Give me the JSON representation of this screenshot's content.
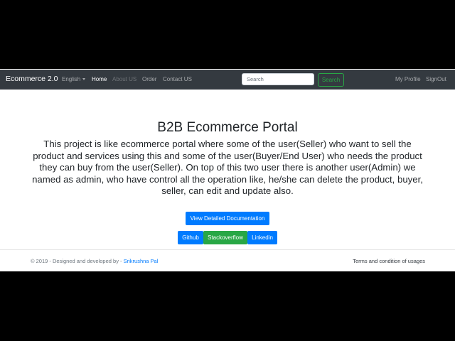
{
  "navbar": {
    "brand": "Ecommerce 2.0",
    "language": "English",
    "home": "Home",
    "about": "About US",
    "order": "Order",
    "contact": "Contact US",
    "search_placeholder": "Search",
    "search_button": "Search",
    "profile": "My Profile",
    "signout": "SignOut"
  },
  "main": {
    "title": "B2B Ecommerce Portal",
    "description": "This project is like ecommerce portal where some of the user(Seller) who want to sell the product and services using this and some of the user(Buyer/End User) who needs the product they can buy from the user(Seller). On top of this two user there is another user(Admin) we named as admin, who have control all the operation like, he/she can delete the product, buyer, seller, can edit and update also.",
    "doc_button": "View Detailed Documentation",
    "github_button": "Github",
    "stackoverflow_button": "Stackoverflow",
    "linkedin_button": "Linkedin"
  },
  "footer": {
    "copyright": "© 2019 - Designed and developed by - ",
    "author": "Srikrushna Pal",
    "terms": "Terms and condition of usages"
  },
  "colors": {
    "navbar_bg": "#343a40",
    "primary": "#007bff",
    "success": "#28a745"
  }
}
